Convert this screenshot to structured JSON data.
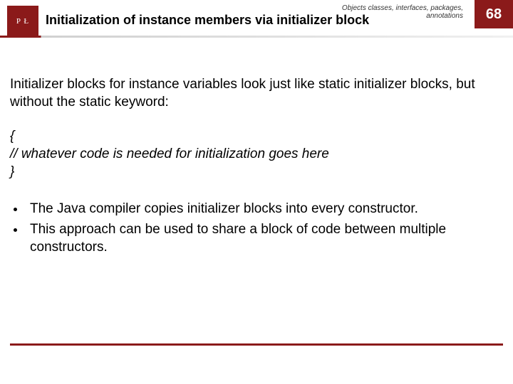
{
  "header": {
    "logo_text": "P Ł",
    "breadcrumb": "Objects classes, interfaces, packages, annotations",
    "title": "Initialization of instance members via initializer block",
    "slide_number": "68"
  },
  "body": {
    "intro": "Initializer blocks for instance variables look just like static initializer blocks, but without the static keyword:",
    "code": {
      "line1": "{",
      "line2": "// whatever code is needed for initialization goes here",
      "line3": "}"
    },
    "bullets": [
      "The Java compiler copies initializer blocks into every constructor.",
      "This approach can be used to share a block of code between multiple constructors."
    ]
  },
  "colors": {
    "brand": "#8b1a1a"
  }
}
